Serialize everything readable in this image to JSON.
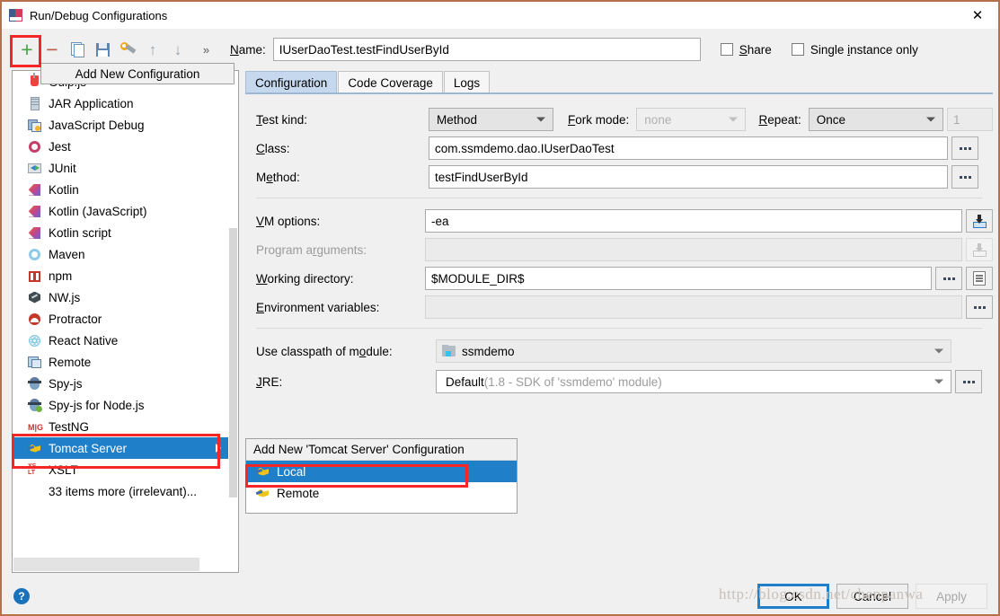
{
  "window": {
    "title": "Run/Debug Configurations",
    "close_label": "✕",
    "app_icon": "intellij-idea-icon"
  },
  "toolbar": {
    "buttons": [
      {
        "name": "add-configuration",
        "icon": "plus-icon",
        "glyph": "+"
      },
      {
        "name": "remove-configuration",
        "icon": "minus-icon",
        "glyph": "–"
      },
      {
        "name": "copy-configuration",
        "icon": "copy-icon",
        "glyph": ""
      },
      {
        "name": "save-configuration",
        "icon": "save-icon",
        "glyph": ""
      },
      {
        "name": "edit-templates",
        "icon": "wrench-icon",
        "glyph": ""
      },
      {
        "name": "move-up",
        "icon": "arrow-up-icon",
        "glyph": "↑"
      },
      {
        "name": "move-down",
        "icon": "arrow-down-icon",
        "glyph": "↓"
      },
      {
        "name": "more-options",
        "icon": "chevron-double-right-icon",
        "glyph": "»"
      }
    ],
    "name_label": "Name:",
    "name_value": "IUserDaoTest.testFindUserById",
    "share_label": "Share",
    "share_checked": false,
    "single_instance_label": "Single instance only",
    "single_instance_checked": false
  },
  "tooltip": {
    "text": "Add New Configuration"
  },
  "config_list": {
    "items": [
      {
        "label": "Gulp.js",
        "icon": "gulp-icon",
        "icon_class": "ic-gulp",
        "selected": false
      },
      {
        "label": "JAR Application",
        "icon": "jar-icon",
        "icon_class": "ic-jar",
        "selected": false
      },
      {
        "label": "JavaScript Debug",
        "icon": "javascript-debug-icon",
        "icon_class": "ic-jsdbg",
        "selected": false
      },
      {
        "label": "Jest",
        "icon": "jest-icon",
        "icon_class": "ic-jest",
        "selected": false
      },
      {
        "label": "JUnit",
        "icon": "junit-icon",
        "icon_class": "ic-junit",
        "selected": false
      },
      {
        "label": "Kotlin",
        "icon": "kotlin-icon",
        "icon_class": "ic-kotlin",
        "selected": false
      },
      {
        "label": "Kotlin (JavaScript)",
        "icon": "kotlin-icon",
        "icon_class": "ic-kotlin",
        "selected": false
      },
      {
        "label": "Kotlin script",
        "icon": "kotlin-icon",
        "icon_class": "ic-kotlin",
        "selected": false
      },
      {
        "label": "Maven",
        "icon": "maven-icon",
        "icon_class": "ic-maven",
        "selected": false
      },
      {
        "label": "npm",
        "icon": "npm-icon",
        "icon_class": "ic-npm",
        "selected": false
      },
      {
        "label": "NW.js",
        "icon": "nwjs-icon",
        "icon_class": "ic-nw",
        "selected": false
      },
      {
        "label": "Protractor",
        "icon": "protractor-icon",
        "icon_class": "ic-prot",
        "selected": false
      },
      {
        "label": "React Native",
        "icon": "react-native-icon",
        "icon_class": "ic-react",
        "selected": false
      },
      {
        "label": "Remote",
        "icon": "remote-icon",
        "icon_class": "ic-remote",
        "selected": false
      },
      {
        "label": "Spy-js",
        "icon": "spy-js-icon",
        "icon_class": "ic-spy",
        "selected": false
      },
      {
        "label": "Spy-js for Node.js",
        "icon": "spy-js-node-icon",
        "icon_class": "ic-spy ic-spy-node",
        "selected": false
      },
      {
        "label": "TestNG",
        "icon": "testng-icon",
        "icon_class": "ic-testng",
        "selected": false
      },
      {
        "label": "Tomcat Server",
        "icon": "tomcat-icon",
        "icon_class": "ic-tomcat",
        "selected": true
      },
      {
        "label": "XSLT",
        "icon": "xslt-icon",
        "icon_class": "ic-xslt",
        "selected": false
      }
    ],
    "more_items_label": "33 items more (irrelevant)..."
  },
  "submenu": {
    "header": "Add New 'Tomcat Server' Configuration",
    "items": [
      {
        "label": "Local",
        "icon": "tomcat-icon",
        "selected": true
      },
      {
        "label": "Remote",
        "icon": "tomcat-icon",
        "selected": false
      }
    ]
  },
  "tabs": [
    {
      "label": "Configuration",
      "active": true
    },
    {
      "label": "Code Coverage",
      "active": false
    },
    {
      "label": "Logs",
      "active": false
    }
  ],
  "form": {
    "test_kind_label": "Test kind:",
    "test_kind_value": "Method",
    "fork_mode_label": "Fork mode:",
    "fork_mode_value": "none",
    "fork_mode_disabled": true,
    "repeat_label": "Repeat:",
    "repeat_value": "Once",
    "repeat_count_value": "1",
    "repeat_count_disabled": true,
    "class_label": "Class:",
    "class_value": "com.ssmdemo.dao.IUserDaoTest",
    "method_label": "Method:",
    "method_value": "testFindUserById",
    "vm_options_label": "VM options:",
    "vm_options_value": "-ea",
    "program_arguments_label": "Program arguments:",
    "program_arguments_value": "",
    "program_arguments_disabled": true,
    "working_directory_label": "Working directory:",
    "working_directory_value": "$MODULE_DIR$",
    "environment_variables_label": "Environment variables:",
    "environment_variables_value": "",
    "use_classpath_label": "Use classpath of module:",
    "use_classpath_value": "ssmdemo",
    "jre_label": "JRE:",
    "jre_value": "Default",
    "jre_detail": " (1.8 - SDK of 'ssmdemo' module)",
    "browse_label": "..."
  },
  "footer": {
    "help_label": "?",
    "ok_label": "OK",
    "cancel_label": "Cancel",
    "apply_label": "Apply",
    "apply_disabled": true
  },
  "watermark": {
    "text": "http://blog.csdn.net/chenpanwa"
  },
  "colors": {
    "selection_blue": "#1f7fc9",
    "highlight_red": "#f62626",
    "window_border": "#b5714a",
    "panel_bg": "#f0f0f0"
  }
}
